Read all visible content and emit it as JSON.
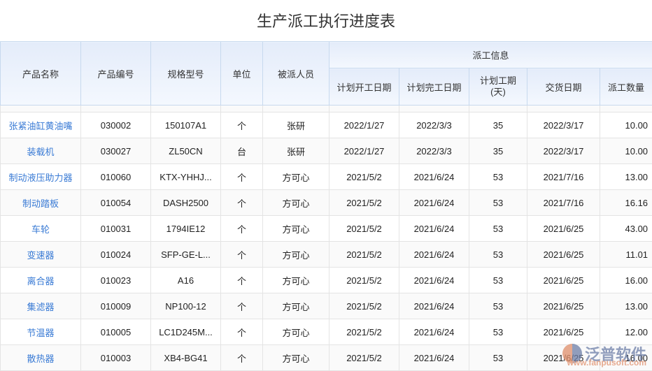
{
  "title": "生产派工执行进度表",
  "headers": {
    "name": "产品名称",
    "code": "产品编号",
    "spec": "规格型号",
    "unit": "单位",
    "person": "被派人员",
    "group": "派工信息",
    "start": "计划开工日期",
    "end": "计划完工日期",
    "days": "计划工期(天)",
    "delivery": "交货日期",
    "qty": "派工数量"
  },
  "rows": [
    [
      "张紧油缸黄油嘴",
      "030002",
      "150107A1",
      "个",
      "张研",
      "2022/1/27",
      "2022/3/3",
      "35",
      "2022/3/17",
      "10.00"
    ],
    [
      "装载机",
      "030027",
      "ZL50CN",
      "台",
      "张研",
      "2022/1/27",
      "2022/3/3",
      "35",
      "2022/3/17",
      "10.00"
    ],
    [
      "制动液压助力器",
      "010060",
      "KTX-YHHJ...",
      "个",
      "方可心",
      "2021/5/2",
      "2021/6/24",
      "53",
      "2021/7/16",
      "13.00"
    ],
    [
      "制动踏板",
      "010054",
      "DASH2500",
      "个",
      "方可心",
      "2021/5/2",
      "2021/6/24",
      "53",
      "2021/7/16",
      "16.16"
    ],
    [
      "车轮",
      "010031",
      "1794IE12",
      "个",
      "方可心",
      "2021/5/2",
      "2021/6/24",
      "53",
      "2021/6/25",
      "43.00"
    ],
    [
      "变速器",
      "010024",
      "SFP-GE-L...",
      "个",
      "方可心",
      "2021/5/2",
      "2021/6/24",
      "53",
      "2021/6/25",
      "11.01"
    ],
    [
      "离合器",
      "010023",
      "A16",
      "个",
      "方可心",
      "2021/5/2",
      "2021/6/24",
      "53",
      "2021/6/25",
      "16.00"
    ],
    [
      "集滤器",
      "010009",
      "NP100-12",
      "个",
      "方可心",
      "2021/5/2",
      "2021/6/24",
      "53",
      "2021/6/25",
      "13.00"
    ],
    [
      "节温器",
      "010005",
      "LC1D245M...",
      "个",
      "方可心",
      "2021/5/2",
      "2021/6/24",
      "53",
      "2021/6/25",
      "12.00"
    ],
    [
      "散热器",
      "010003",
      "XB4-BG41",
      "个",
      "方可心",
      "2021/5/2",
      "2021/6/24",
      "53",
      "2021/6/25",
      "16.00"
    ]
  ],
  "watermark": {
    "brand": "泛普软件",
    "url": "www.fanpusoft.com"
  }
}
